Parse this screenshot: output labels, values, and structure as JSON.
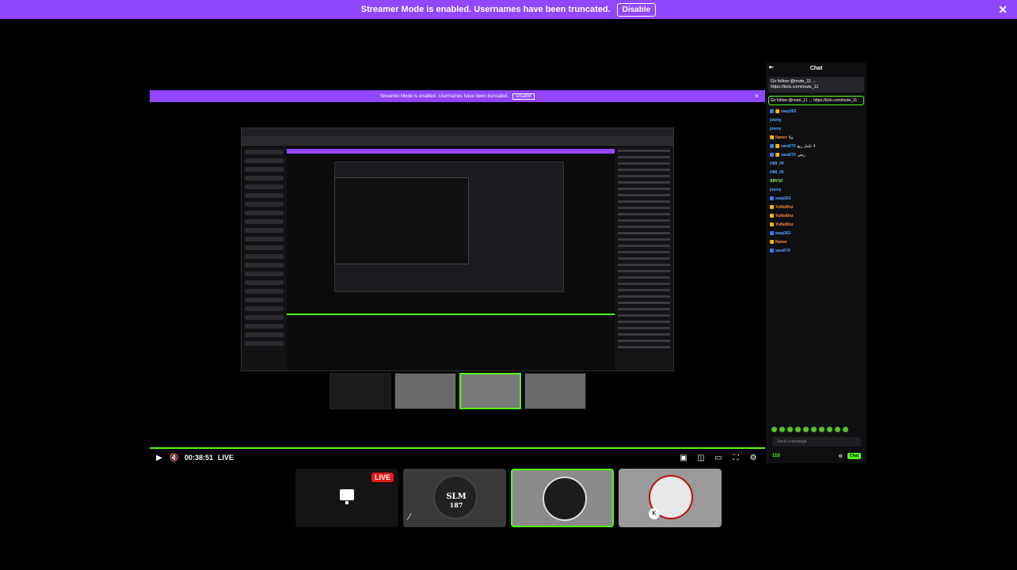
{
  "banner": {
    "message": "Streamer Mode is enabled. Usernames have been truncated.",
    "disable_label": "Disable",
    "close_glyph": "✕"
  },
  "nested_banner": {
    "message": "Streamer Mode is enabled. Usernames have been truncated.",
    "disable_label": "Disable"
  },
  "player": {
    "time": "00:38:51",
    "live_label": "LIVE"
  },
  "thumbnails": [
    {
      "kind": "screen",
      "badge": "LIVE"
    },
    {
      "kind": "avatar",
      "title": "SLM",
      "subtitle": "187"
    },
    {
      "kind": "avatar",
      "selected": true
    },
    {
      "kind": "avatar"
    }
  ],
  "chat": {
    "title": "Chat",
    "pinned_line1": "Go follow @mute_11 →",
    "pinned_line2": "https://kick.com/mute_11",
    "highlight": "Go follow @mute_11 → https://kick.com/mute_11",
    "messages": [
      {
        "user": "waqi363"
      },
      {
        "user": "jimmy"
      },
      {
        "user": "jimmy"
      },
      {
        "user": "Ilamer",
        "text": "ولا"
      },
      {
        "user": "sara570",
        "text": "لا تكمل ربع"
      },
      {
        "user": "sara570",
        "text": "ريس"
      },
      {
        "user": "H88_00"
      },
      {
        "user": "H88_00"
      },
      {
        "user": "ARY10"
      },
      {
        "user": "jimmy"
      },
      {
        "user": "waqi363"
      },
      {
        "user": "YuNol0nz"
      },
      {
        "user": "YuNol0nz"
      },
      {
        "user": "YuNol0nz"
      },
      {
        "user": "waqi363"
      },
      {
        "user": "Ilamer"
      },
      {
        "user": "sara570"
      }
    ],
    "input_placeholder": "Send a message",
    "viewer_count": "110",
    "send_label": "Chat"
  },
  "colors": {
    "accent_purple": "#9146ff",
    "kick_green": "#53fc18",
    "live_red": "#e91916"
  }
}
